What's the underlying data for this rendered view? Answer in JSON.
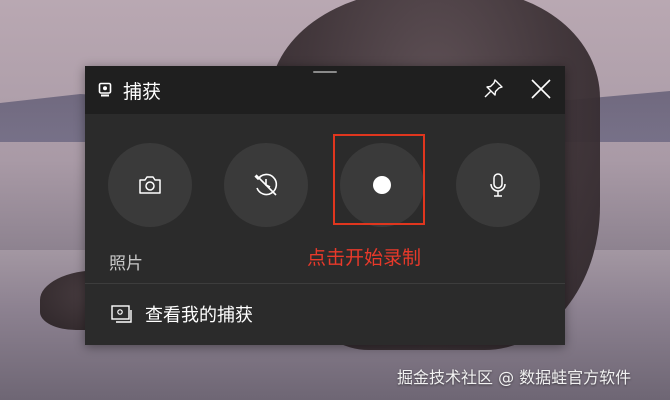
{
  "panel": {
    "title": "捕获",
    "buttons": [
      {
        "name": "camera-icon",
        "label": "照片"
      },
      {
        "name": "screenshot-no-icon"
      },
      {
        "name": "record-icon"
      },
      {
        "name": "microphone-icon"
      }
    ],
    "photo_label": "照片",
    "view_captures": "查看我的捕获"
  },
  "annotation": "点击开始录制",
  "watermark": "掘金技术社区 @ 数据蛙官方软件",
  "colors": {
    "panel_bg": "#2b2b2b",
    "titlebar_bg": "#1f1f1f",
    "highlight": "#e0361e"
  }
}
